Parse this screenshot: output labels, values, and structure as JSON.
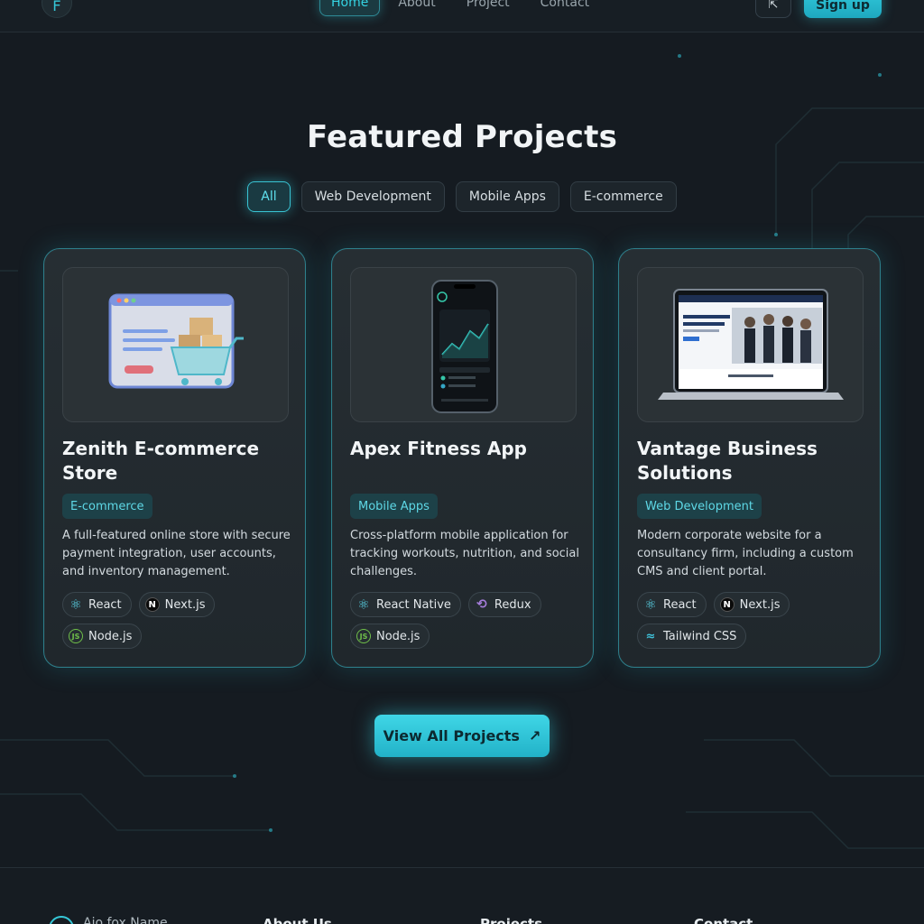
{
  "header": {
    "nav": [
      "Home",
      "About",
      "Project",
      "Contact"
    ],
    "signup_label": "Sign up"
  },
  "section": {
    "title": "Featured Projects",
    "filters": [
      "All",
      "Web Development",
      "Mobile Apps",
      "E-commerce"
    ],
    "active_filter": "All"
  },
  "projects": [
    {
      "title": "Zenith E-commerce Store",
      "tag": "E-commerce",
      "description": "A full-featured online store with secure payment integration, user accounts, and inventory management.",
      "stack": [
        "React",
        "Next.js",
        "Node.js"
      ],
      "stack_icons": [
        "react-icon",
        "nextjs-icon",
        "nodejs-icon"
      ]
    },
    {
      "title": "Apex Fitness App",
      "tag": "Mobile Apps",
      "description": "Cross-platform mobile application for tracking workouts, nutrition, and social challenges.",
      "stack": [
        "React Native",
        "Redux",
        "Node.js"
      ],
      "stack_icons": [
        "react-icon",
        "redux-icon",
        "nodejs-icon"
      ]
    },
    {
      "title": "Vantage Business Solutions",
      "tag": "Web Development",
      "description": "Modern corporate website for a consultancy firm, including a custom CMS and client portal.",
      "stack": [
        "React",
        "Next.js",
        "Tailwind CSS"
      ],
      "stack_icons": [
        "react-icon",
        "nextjs-icon",
        "tailwind-icon"
      ]
    }
  ],
  "cta": {
    "label": "View All Projects",
    "icon": "arrow-up-right-icon"
  },
  "footer": {
    "brand": "Ajo fox Name",
    "columns": [
      "About Us",
      "Projects",
      "Contact"
    ]
  },
  "colors": {
    "accent": "#35d3e2",
    "background": "#151b21",
    "card": "#242b30"
  }
}
